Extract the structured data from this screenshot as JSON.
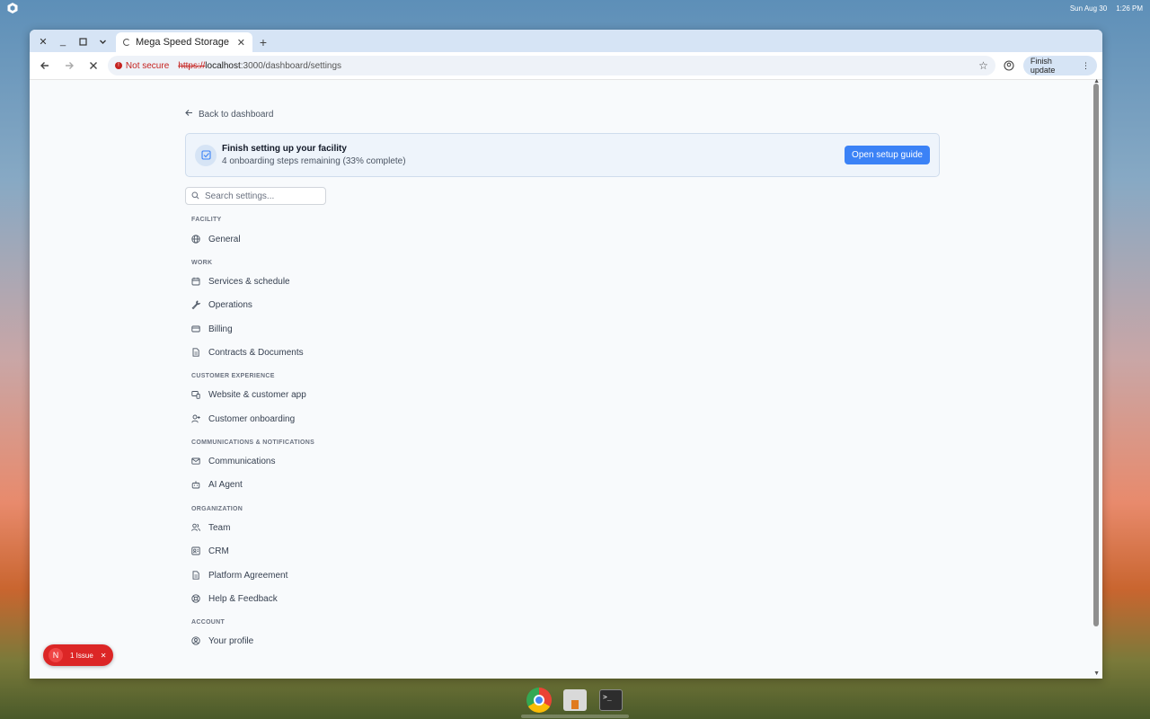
{
  "os": {
    "date": "Sun Aug 30",
    "time": "1:26 PM"
  },
  "browser": {
    "tab_title": "Mega Speed Storage",
    "security_label": "Not secure",
    "url_scheme": "https://",
    "url_host": "localhost",
    "url_path": ":3000/dashboard/settings",
    "finish_update_label": "Finish update"
  },
  "page": {
    "back_label": "Back to dashboard",
    "banner": {
      "title": "Finish setting up your facility",
      "subtitle": "4 onboarding steps remaining (33% complete)",
      "button_label": "Open setup guide"
    },
    "search": {
      "placeholder": "Search settings..."
    },
    "sections": [
      {
        "label": "FACILITY",
        "items": [
          {
            "label": "General",
            "icon": "globe-icon"
          }
        ]
      },
      {
        "label": "WORK",
        "items": [
          {
            "label": "Services & schedule",
            "icon": "calendar-icon"
          },
          {
            "label": "Operations",
            "icon": "wrench-icon"
          },
          {
            "label": "Billing",
            "icon": "credit-card-icon"
          },
          {
            "label": "Contracts & Documents",
            "icon": "document-icon"
          }
        ]
      },
      {
        "label": "CUSTOMER EXPERIENCE",
        "items": [
          {
            "label": "Website & customer app",
            "icon": "devices-icon"
          },
          {
            "label": "Customer onboarding",
            "icon": "user-plus-icon"
          }
        ]
      },
      {
        "label": "COMMUNICATIONS & NOTIFICATIONS",
        "items": [
          {
            "label": "Communications",
            "icon": "mail-icon"
          },
          {
            "label": "AI Agent",
            "icon": "robot-icon"
          }
        ]
      },
      {
        "label": "ORGANIZATION",
        "items": [
          {
            "label": "Team",
            "icon": "users-icon"
          },
          {
            "label": "CRM",
            "icon": "contact-card-icon"
          },
          {
            "label": "Platform Agreement",
            "icon": "document-icon"
          },
          {
            "label": "Help & Feedback",
            "icon": "lifebuoy-icon"
          }
        ]
      },
      {
        "label": "ACCOUNT",
        "items": [
          {
            "label": "Your profile",
            "icon": "user-circle-icon"
          }
        ]
      }
    ]
  },
  "dev_overlay": {
    "avatar_letter": "N",
    "issues_label": "1 Issue"
  }
}
